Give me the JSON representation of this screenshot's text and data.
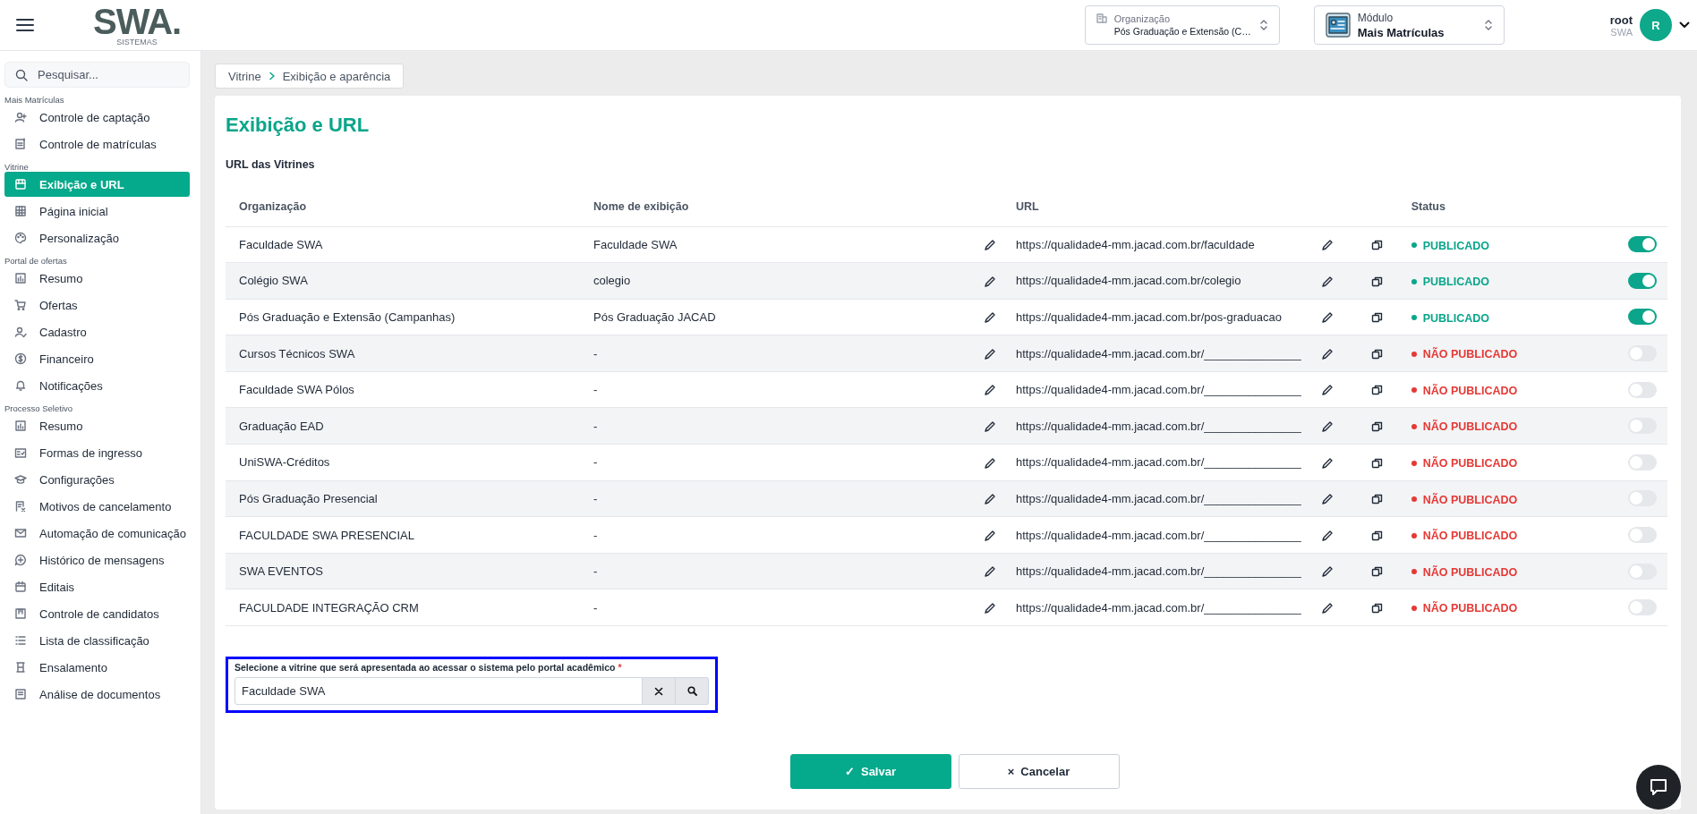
{
  "header": {
    "logo": {
      "text": "SWA.",
      "subtitle": "SISTEMAS"
    },
    "organization": {
      "label": "Organização",
      "value": "Pós Graduação e Extensão (C…"
    },
    "module": {
      "label": "Módulo",
      "value": "Mais Matrículas"
    },
    "user": {
      "name": "root",
      "org": "SWA",
      "initial": "R"
    }
  },
  "sidebar": {
    "search": {
      "placeholder": "Pesquisar..."
    },
    "sections": [
      {
        "title": "Mais Matrículas",
        "items": [
          {
            "label": "Controle de captação",
            "selected": false
          },
          {
            "label": "Controle de matrículas",
            "selected": false
          }
        ]
      },
      {
        "title": "Vitrine",
        "items": [
          {
            "label": "Exibição e URL",
            "selected": true
          },
          {
            "label": "Página inicial",
            "selected": false
          },
          {
            "label": "Personalização",
            "selected": false
          }
        ]
      },
      {
        "title": "Portal de ofertas",
        "items": [
          {
            "label": "Resumo",
            "selected": false
          },
          {
            "label": "Ofertas",
            "selected": false
          },
          {
            "label": "Cadastro",
            "selected": false
          },
          {
            "label": "Financeiro",
            "selected": false
          },
          {
            "label": "Notificações",
            "selected": false
          }
        ]
      },
      {
        "title": "Processo Seletivo",
        "items": [
          {
            "label": "Resumo",
            "selected": false
          },
          {
            "label": "Formas de ingresso",
            "selected": false
          },
          {
            "label": "Configurações",
            "selected": false
          },
          {
            "label": "Motivos de cancelamento",
            "selected": false
          },
          {
            "label": "Automação de comunicação",
            "selected": false
          },
          {
            "label": "Histórico de mensagens",
            "selected": false
          },
          {
            "label": "Editais",
            "selected": false
          },
          {
            "label": "Controle de candidatos",
            "selected": false
          },
          {
            "label": "Lista de classificação",
            "selected": false
          },
          {
            "label": "Ensalamento",
            "selected": false
          },
          {
            "label": "Análise de documentos",
            "selected": false
          }
        ]
      }
    ]
  },
  "breadcrumb": [
    "Vitrine",
    "Exibição e aparência"
  ],
  "page_title": "Exibição e URL",
  "section_title": "URL das Vitrines",
  "table": {
    "columns": [
      "Organização",
      "Nome de exibição",
      "URL",
      "Status"
    ],
    "rows": [
      {
        "organization": "Faculdade SWA",
        "display_name": "Faculdade SWA",
        "url": "https://qualidade4-mm.jacad.com.br/faculdade",
        "status": "PUBLICADO",
        "published": true
      },
      {
        "organization": "Colégio SWA",
        "display_name": "colegio",
        "url": "https://qualidade4-mm.jacad.com.br/colegio",
        "status": "PUBLICADO",
        "published": true
      },
      {
        "organization": "Pós Graduação e Extensão (Campanhas)",
        "display_name": "Pós Graduação JACAD",
        "url": "https://qualidade4-mm.jacad.com.br/pos-graduacao",
        "status": "PUBLICADO",
        "published": true
      },
      {
        "organization": "Cursos Técnicos SWA",
        "display_name": "-",
        "url": "https://qualidade4-mm.jacad.com.br/_______________",
        "status": "NÃO PUBLICADO",
        "published": false
      },
      {
        "organization": "Faculdade SWA Pólos",
        "display_name": "-",
        "url": "https://qualidade4-mm.jacad.com.br/_______________",
        "status": "NÃO PUBLICADO",
        "published": false
      },
      {
        "organization": "Graduação EAD",
        "display_name": "-",
        "url": "https://qualidade4-mm.jacad.com.br/_______________",
        "status": "NÃO PUBLICADO",
        "published": false
      },
      {
        "organization": "UniSWA-Créditos",
        "display_name": "-",
        "url": "https://qualidade4-mm.jacad.com.br/_______________",
        "status": "NÃO PUBLICADO",
        "published": false
      },
      {
        "organization": "Pós Graduação Presencial",
        "display_name": "-",
        "url": "https://qualidade4-mm.jacad.com.br/_______________",
        "status": "NÃO PUBLICADO",
        "published": false
      },
      {
        "organization": "FACULDADE SWA PRESENCIAL",
        "display_name": "-",
        "url": "https://qualidade4-mm.jacad.com.br/_______________",
        "status": "NÃO PUBLICADO",
        "published": false
      },
      {
        "organization": "SWA EVENTOS",
        "display_name": "-",
        "url": "https://qualidade4-mm.jacad.com.br/_______________",
        "status": "NÃO PUBLICADO",
        "published": false
      },
      {
        "organization": "FACULDADE INTEGRAÇÃO CRM",
        "display_name": "-",
        "url": "https://qualidade4-mm.jacad.com.br/_______________",
        "status": "NÃO PUBLICADO",
        "published": false
      }
    ]
  },
  "default_showcase": {
    "label": "Selecione a vitrine que será apresentada ao acessar o sistema pelo portal acadêmico",
    "required_mark": "*",
    "value": "Faculdade SWA",
    "focused": true
  },
  "buttons": [
    {
      "kind": "primary",
      "icon": "✓",
      "label": "Salvar"
    },
    {
      "kind": "secondary",
      "icon": "×",
      "label": "Cancelar"
    }
  ]
}
